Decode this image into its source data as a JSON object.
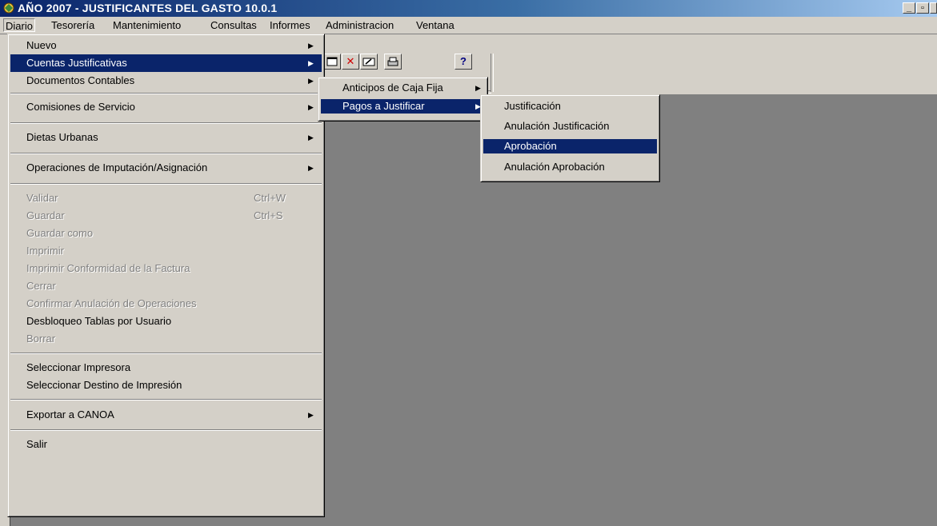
{
  "window": {
    "title": "AÑO 2007 - JUSTIFICANTES DEL GASTO 10.0.1",
    "controls": [
      "_",
      "▫",
      "✕"
    ]
  },
  "menubar": {
    "items": [
      "Diario",
      "Tesorería",
      "Mantenimiento",
      "Consultas",
      "Informes",
      "Administracion",
      "Ventana"
    ]
  },
  "toolbar": {
    "buttons": [
      "✕",
      "?"
    ]
  },
  "diario_menu": {
    "items": [
      {
        "label": "Nuevo"
      },
      {
        "label": "Cuentas Justificativas"
      },
      {
        "label": "Documentos Contables"
      },
      {
        "label": "Comisiones de Servicio"
      },
      {
        "label": "Dietas Urbanas"
      },
      {
        "label": "Operaciones de Imputación/Asignación"
      },
      {
        "label": "Validar",
        "shortcut": "Ctrl+W"
      },
      {
        "label": "Guardar",
        "shortcut": "Ctrl+S"
      },
      {
        "label": "Guardar como"
      },
      {
        "label": "Imprimir"
      },
      {
        "label": "Imprimir Conformidad de la Factura"
      },
      {
        "label": "Cerrar"
      },
      {
        "label": "Confirmar Anulación de Operaciones"
      },
      {
        "label": "Desbloqueo Tablas por Usuario"
      },
      {
        "label": "Borrar"
      },
      {
        "label": "Seleccionar Impresora"
      },
      {
        "label": "Seleccionar Destino de Impresión"
      },
      {
        "label": "Exportar a CANOA"
      },
      {
        "label": "Salir"
      }
    ]
  },
  "cuentas_submenu": {
    "items": [
      {
        "label": "Anticipos de Caja Fija"
      },
      {
        "label": "Pagos a Justificar"
      }
    ]
  },
  "pagos_submenu": {
    "items": [
      {
        "label": "Justificación"
      },
      {
        "label": "Anulación Justificación"
      },
      {
        "label": "Aprobación"
      },
      {
        "label": "Anulación Aprobación"
      }
    ]
  },
  "colors": {
    "highlight": "#0a246a",
    "face": "#d4d0c8",
    "client": "#808080"
  }
}
